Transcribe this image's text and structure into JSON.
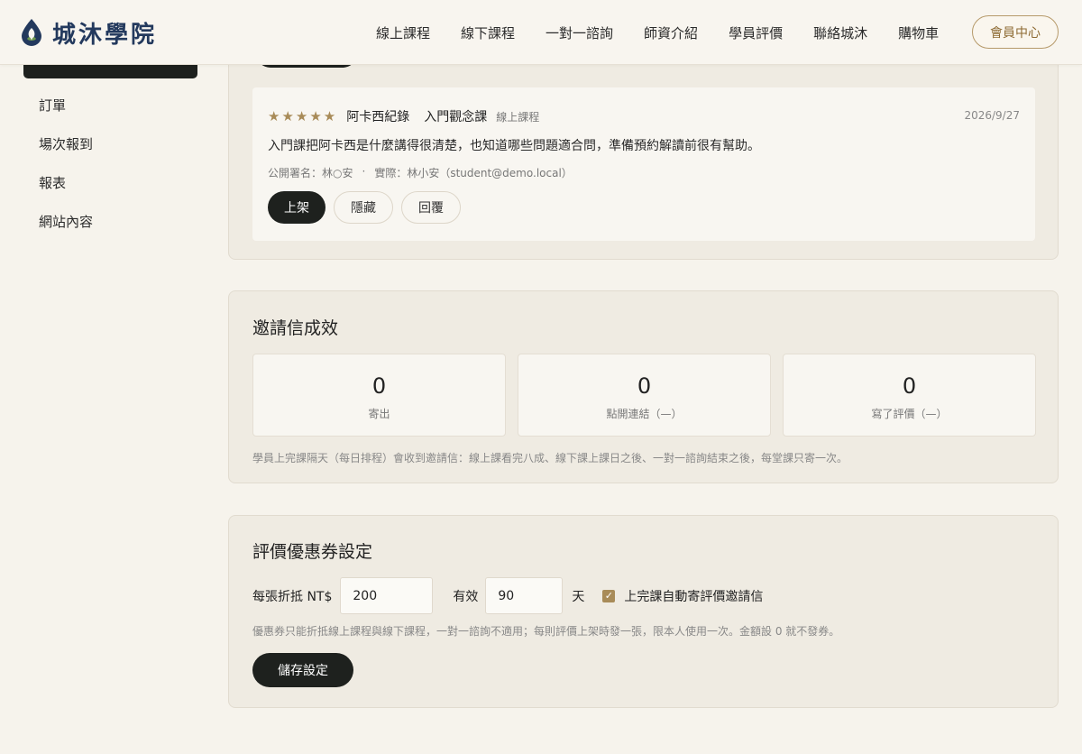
{
  "header": {
    "logo_text": "城沐學院",
    "nav": [
      "線上課程",
      "線下課程",
      "一對一諮詢",
      "師資介紹",
      "學員評價",
      "聯絡城沐",
      "購物車"
    ],
    "member_label": "會員中心"
  },
  "sidebar": {
    "items": [
      "訂單",
      "場次報到",
      "報表",
      "網站內容"
    ]
  },
  "review": {
    "stars": "★★★★★",
    "lecturer": "阿卡西紀錄",
    "course": "入門觀念課",
    "course_type": "線上課程",
    "date": "2026/9/27",
    "body": "入門課把阿卡西是什麼講得很清楚，也知道哪些問題適合問，準備預約解讀前很有幫助。",
    "public_name": "公開署名：林○安",
    "separator": "·",
    "real_name": "實際：林小安（student@demo.local）",
    "actions": {
      "publish": "上架",
      "hide": "隱藏",
      "reply": "回覆"
    }
  },
  "invite": {
    "title": "邀請信成效",
    "stats": [
      {
        "value": "0",
        "label": "寄出"
      },
      {
        "value": "0",
        "label": "點開連結（—）"
      },
      {
        "value": "0",
        "label": "寫了評價（—）"
      }
    ],
    "note": "學員上完課隔天（每日排程）會收到邀請信：線上課看完八成、線下課上課日之後、一對一諮詢結束之後，每堂課只寄一次。"
  },
  "coupon": {
    "title": "評價優惠券設定",
    "amount_label": "每張折抵 NT$",
    "amount_value": "200",
    "valid_label": "有效",
    "days_value": "90",
    "days_unit": "天",
    "auto_label": "上完課自動寄評價邀請信",
    "auto_checked": true,
    "note": "優惠券只能折抵線上課程與線下課程，一對一諮詢不適用；每則評價上架時發一張，限本人使用一次。金額設 0 就不發券。",
    "save_label": "儲存設定"
  },
  "colors": {
    "accent": "#a88b58",
    "dark": "#1e211e",
    "brand": "#23395d"
  }
}
